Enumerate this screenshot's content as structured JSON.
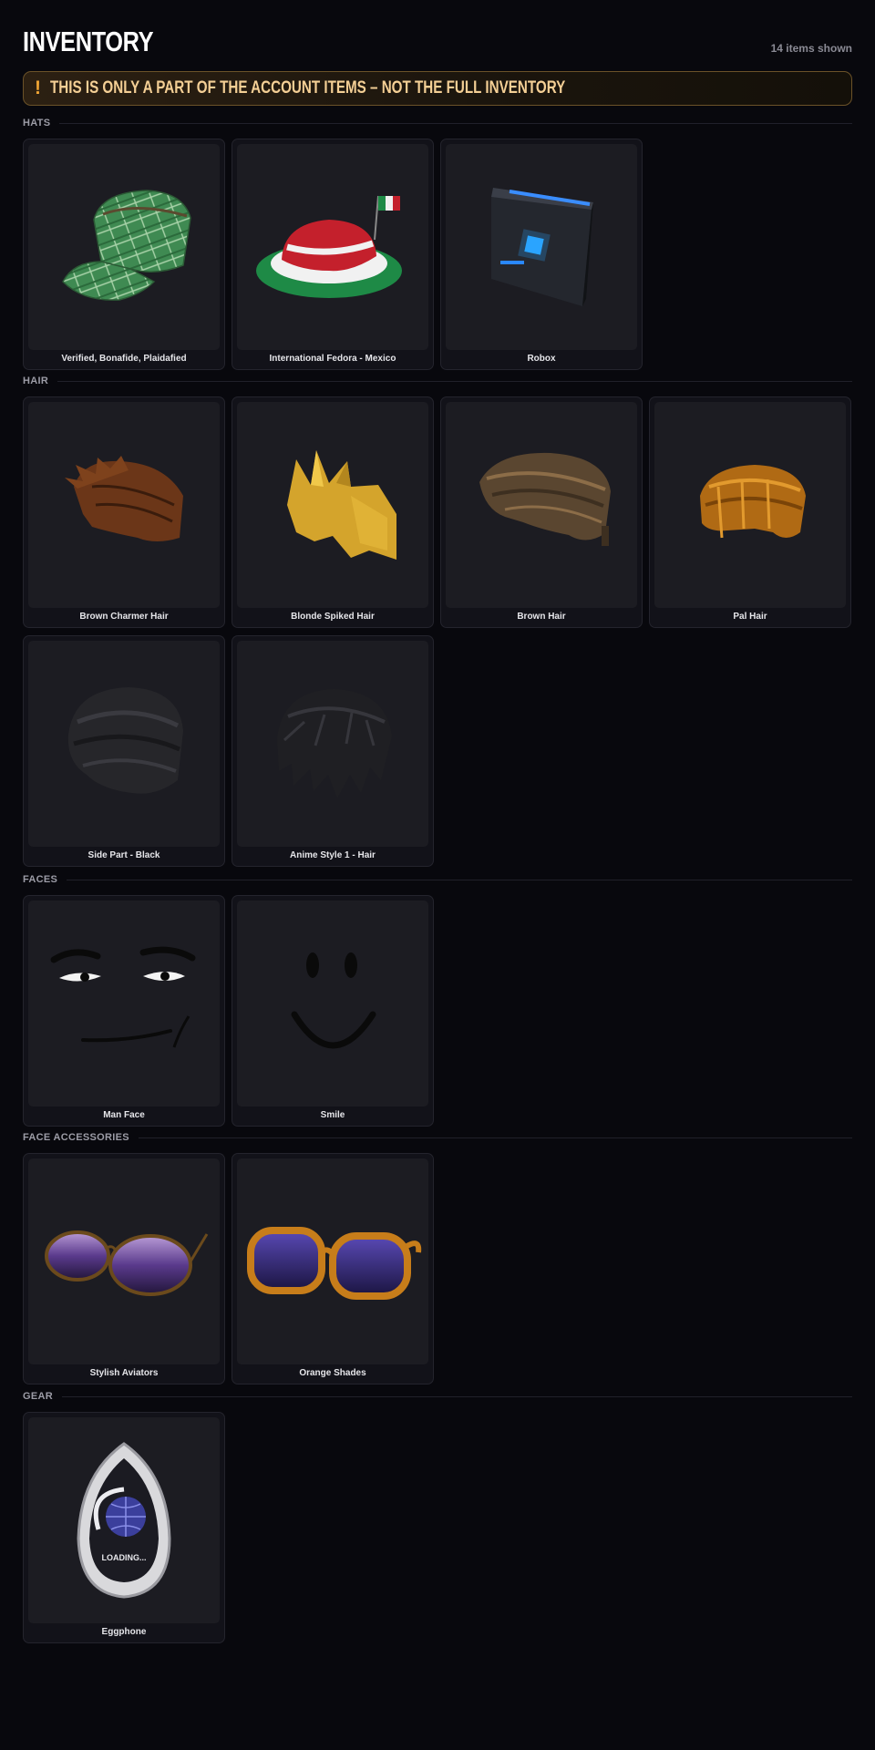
{
  "header": {
    "title": "INVENTORY",
    "count": "14 items shown"
  },
  "banner": {
    "icon": "!",
    "text": "THIS IS ONLY A PART OF THE ACCOUNT ITEMS – NOT THE FULL INVENTORY",
    "color": "#f4cf95",
    "icon_name": "warning-icon"
  },
  "sections": [
    {
      "label": "HATS",
      "items": [
        {
          "name": "Verified, Bonafide, Plaidafied",
          "icon": "plaid-cap-icon"
        },
        {
          "name": "International Fedora - Mexico",
          "icon": "mexico-fedora-icon"
        },
        {
          "name": "Robox",
          "icon": "robox-icon"
        }
      ]
    },
    {
      "label": "HAIR",
      "items": [
        {
          "name": "Brown Charmer Hair",
          "icon": "brown-charmer-hair-icon"
        },
        {
          "name": "Blonde Spiked Hair",
          "icon": "blonde-spiked-hair-icon"
        },
        {
          "name": "Brown Hair",
          "icon": "brown-hair-icon"
        },
        {
          "name": "Pal Hair",
          "icon": "pal-hair-icon"
        },
        {
          "name": "Side Part - Black",
          "icon": "side-part-hair-icon"
        },
        {
          "name": "Anime Style 1 - Hair",
          "icon": "anime-hair-icon"
        }
      ]
    },
    {
      "label": "FACES",
      "items": [
        {
          "name": "Man Face",
          "icon": "man-face-icon"
        },
        {
          "name": "Smile",
          "icon": "smile-face-icon"
        }
      ]
    },
    {
      "label": "FACE ACCESSORIES",
      "items": [
        {
          "name": "Stylish Aviators",
          "icon": "aviators-icon"
        },
        {
          "name": "Orange Shades",
          "icon": "orange-shades-icon"
        }
      ]
    },
    {
      "label": "GEAR",
      "items": [
        {
          "name": "Eggphone",
          "icon": "eggphone-icon",
          "screen_text": "LOADING..."
        }
      ]
    }
  ]
}
